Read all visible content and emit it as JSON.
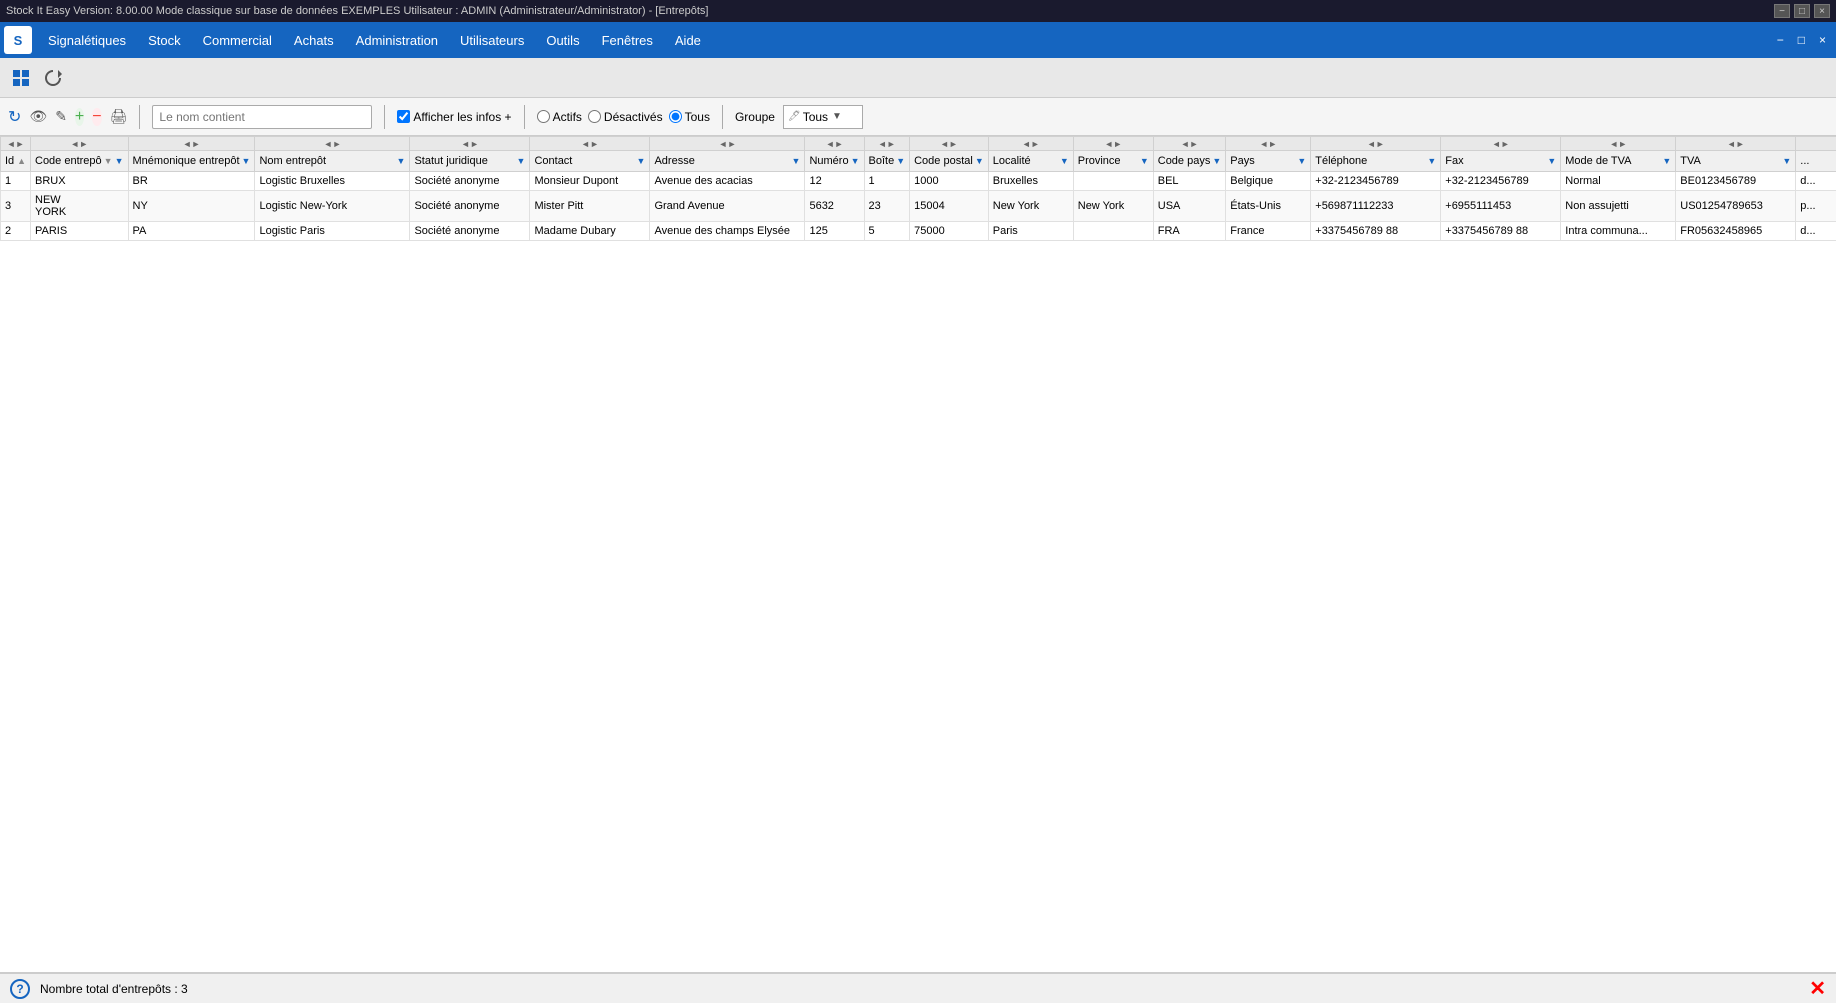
{
  "titlebar": {
    "title": "Stock It Easy Version: 8.00.00  Mode  classique sur base de données EXEMPLES Utilisateur : ADMIN (Administrateur/Administrator) - [Entrepôts]",
    "buttons": [
      "−",
      "□",
      "×"
    ]
  },
  "menubar": {
    "logo": "S",
    "items": [
      "Signalétiques",
      "Stock",
      "Commercial",
      "Achats",
      "Administration",
      "Utilisateurs",
      "Outils",
      "Fenêtres",
      "Aide"
    ],
    "window_buttons": [
      "−",
      "□",
      "×"
    ]
  },
  "toolbar": {
    "icons": [
      "↻",
      "👁",
      "✎",
      "➕",
      "⛔",
      "🖨"
    ]
  },
  "filterbar": {
    "search_placeholder": "Le nom contient",
    "checkbox_label": "Afficher les infos +",
    "radio_actifs": "Actifs",
    "radio_desactives": "Désactivés",
    "radio_tous": "Tous",
    "groupe_label": "Groupe",
    "groupe_value": "Tous",
    "checkbox_checked": true,
    "tous_selected": true
  },
  "table": {
    "resize_arrows": [
      "◄►",
      "◄►",
      "◄►",
      "◄►",
      "◄►",
      "◄►",
      "◄►",
      "◄►",
      "◄►",
      "◄►",
      "◄►",
      "◄►",
      "◄►",
      "◄►",
      "◄►",
      "◄►",
      "◄►",
      "◄►"
    ],
    "columns": [
      {
        "id": "id",
        "label": "Id",
        "sortable": true,
        "filterable": false
      },
      {
        "id": "code",
        "label": "Code entrepô",
        "sortable": true,
        "filterable": true
      },
      {
        "id": "mnem",
        "label": "Mnémonique entrepôt",
        "sortable": true,
        "filterable": true
      },
      {
        "id": "nom",
        "label": "Nom entrepôt",
        "sortable": true,
        "filterable": true
      },
      {
        "id": "statut",
        "label": "Statut juridique",
        "sortable": true,
        "filterable": true
      },
      {
        "id": "contact",
        "label": "Contact",
        "sortable": true,
        "filterable": true
      },
      {
        "id": "adresse",
        "label": "Adresse",
        "sortable": true,
        "filterable": true
      },
      {
        "id": "num",
        "label": "Numéro",
        "sortable": true,
        "filterable": true
      },
      {
        "id": "boite",
        "label": "Boîte",
        "sortable": true,
        "filterable": true
      },
      {
        "id": "cp",
        "label": "Code postal",
        "sortable": true,
        "filterable": true
      },
      {
        "id": "loc",
        "label": "Localité",
        "sortable": true,
        "filterable": true
      },
      {
        "id": "prov",
        "label": "Province",
        "sortable": true,
        "filterable": true
      },
      {
        "id": "cpays",
        "label": "Code pays",
        "sortable": true,
        "filterable": true
      },
      {
        "id": "pays",
        "label": "Pays",
        "sortable": true,
        "filterable": true
      },
      {
        "id": "tel",
        "label": "Téléphone",
        "sortable": true,
        "filterable": true
      },
      {
        "id": "fax",
        "label": "Fax",
        "sortable": true,
        "filterable": true
      },
      {
        "id": "modetva",
        "label": "Mode de TVA",
        "sortable": true,
        "filterable": true
      },
      {
        "id": "tva",
        "label": "TVA",
        "sortable": true,
        "filterable": true
      },
      {
        "id": "extra",
        "label": "...",
        "sortable": false,
        "filterable": false
      }
    ],
    "rows": [
      {
        "id": "1",
        "code": "BRUX",
        "mnem": "BR",
        "nom": "Logistic Bruxelles",
        "statut": "Société anonyme",
        "contact": "Monsieur Dupont",
        "adresse": "Avenue des acacias",
        "num": "12",
        "boite": "1",
        "cp": "1000",
        "loc": "Bruxelles",
        "prov": "",
        "cpays": "BEL",
        "pays": "Belgique",
        "tel": "+32-2123456789",
        "fax": "+32-2123456789",
        "modetva": "Normal",
        "tva": "BE0123456789",
        "extra": "d..."
      },
      {
        "id": "3",
        "code": "NEW\nYORK",
        "mnem": "NY",
        "nom": "Logistic New-York",
        "statut": "Société anonyme",
        "contact": "Mister Pitt",
        "adresse": "Grand Avenue",
        "num": "5632",
        "boite": "23",
        "cp": "15004",
        "loc": "New York",
        "prov": "New York",
        "cpays": "USA",
        "pays": "États-Unis",
        "tel": "+569871112233",
        "fax": "+6955111453",
        "modetva": "Non assujetti",
        "tva": "US01254789653",
        "extra": "p..."
      },
      {
        "id": "2",
        "code": "PARIS",
        "mnem": "PA",
        "nom": "Logistic Paris",
        "statut": "Société anonyme",
        "contact": "Madame Dubary",
        "adresse": "Avenue des champs Elysée",
        "num": "125",
        "boite": "5",
        "cp": "75000",
        "loc": "Paris",
        "prov": "",
        "cpays": "FRA",
        "pays": "France",
        "tel": "+3375456789 88",
        "fax": "+3375456789 88",
        "modetva": "Intra communa...",
        "tva": "FR05632458965",
        "extra": "d..."
      }
    ]
  },
  "statusbar": {
    "text": "Nombre total d'entrepôts : 3",
    "help_icon": "?",
    "close_icon": "✕"
  }
}
